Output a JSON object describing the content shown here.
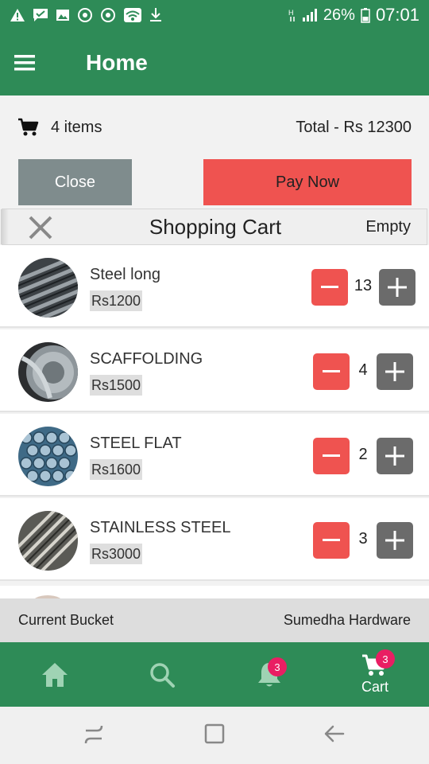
{
  "status_bar": {
    "icons": [
      "warning-icon",
      "message-icon",
      "image-icon",
      "sync-icon",
      "sync-icon",
      "wifi-icon",
      "download-icon",
      "network-h-icon",
      "signal-icon",
      "battery-icon"
    ],
    "battery": "26%",
    "time": "07:01"
  },
  "app_bar": {
    "title": "Home",
    "menu_icon": "hamburger-menu-icon"
  },
  "summary": {
    "items_count": "4 items",
    "total": "Total - Rs 12300"
  },
  "actions": {
    "close_label": "Close",
    "pay_label": "Pay Now"
  },
  "cart_header": {
    "title": "Shopping Cart",
    "empty_label": "Empty"
  },
  "cart_items": [
    {
      "name": "Steel long",
      "price": "Rs1200",
      "qty": "13"
    },
    {
      "name": "SCAFFOLDING",
      "price": "Rs1500",
      "qty": "4"
    },
    {
      "name": "STEEL FLAT",
      "price": "Rs1600",
      "qty": "2"
    },
    {
      "name": "STAINLESS STEEL",
      "price": "Rs3000",
      "qty": "3"
    }
  ],
  "bucket": {
    "label": "Current Bucket",
    "store": "Sumedha Hardware"
  },
  "bottom_nav": {
    "items": [
      {
        "icon": "home-icon"
      },
      {
        "icon": "search-icon"
      },
      {
        "icon": "bell-icon",
        "badge": "3"
      },
      {
        "icon": "cart-icon",
        "badge": "3",
        "label": "Cart"
      }
    ]
  },
  "colors": {
    "primary": "#2e8b57",
    "danger": "#ef5350",
    "neutral": "#7f8c8d",
    "badge": "#e91e63"
  }
}
